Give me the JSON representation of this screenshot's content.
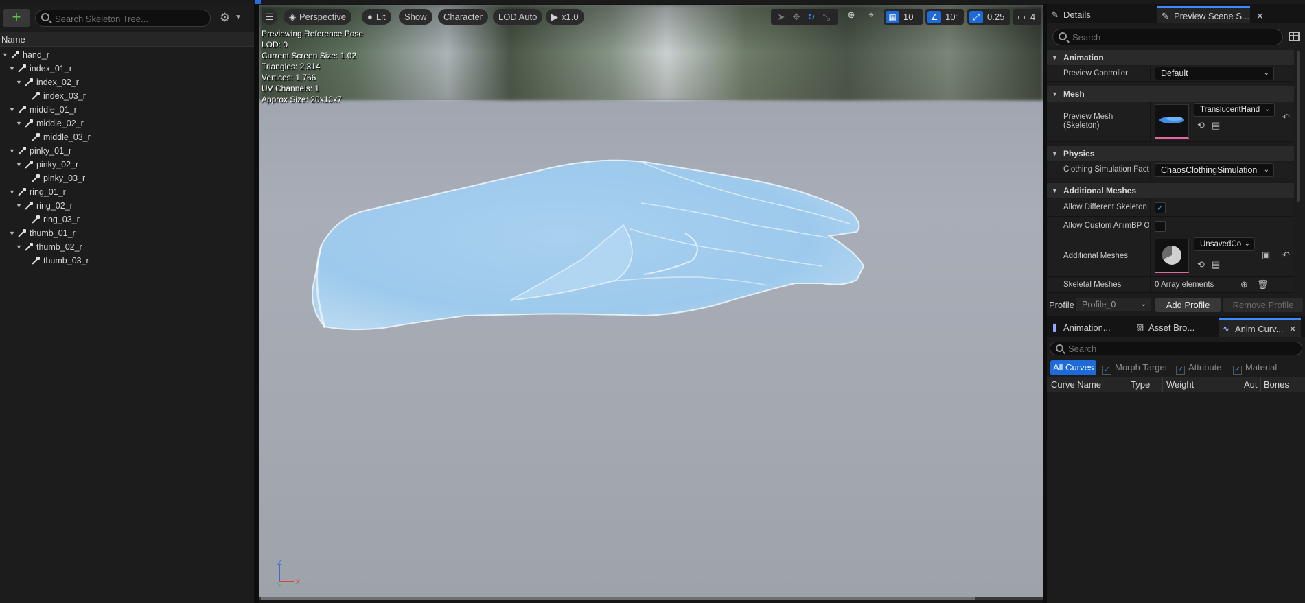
{
  "skeleton_tree": {
    "add_label": "+",
    "search_placeholder": "Search Skeleton Tree...",
    "column_name": "Name",
    "bones": [
      {
        "name": "hand_r",
        "depth": 0
      },
      {
        "name": "index_01_r",
        "depth": 1
      },
      {
        "name": "index_02_r",
        "depth": 2
      },
      {
        "name": "index_03_r",
        "depth": 3
      },
      {
        "name": "middle_01_r",
        "depth": 1
      },
      {
        "name": "middle_02_r",
        "depth": 2
      },
      {
        "name": "middle_03_r",
        "depth": 3
      },
      {
        "name": "pinky_01_r",
        "depth": 1
      },
      {
        "name": "pinky_02_r",
        "depth": 2
      },
      {
        "name": "pinky_03_r",
        "depth": 3
      },
      {
        "name": "ring_01_r",
        "depth": 1
      },
      {
        "name": "ring_02_r",
        "depth": 2
      },
      {
        "name": "ring_03_r",
        "depth": 3
      },
      {
        "name": "thumb_01_r",
        "depth": 1
      },
      {
        "name": "thumb_02_r",
        "depth": 2
      },
      {
        "name": "thumb_03_r",
        "depth": 3
      }
    ]
  },
  "viewport": {
    "toolbar": {
      "menu_icon": "hamburger-icon",
      "perspective": "Perspective",
      "lit": "Lit",
      "show": "Show",
      "character": "Character",
      "lod": "LOD Auto",
      "play_speed": "x1.0",
      "grid_snap": "10",
      "rotation_snap": "10°",
      "scale_snap": "0.25",
      "camera_speed": "4"
    },
    "stats": [
      "Previewing Reference Pose",
      "LOD: 0",
      "Current Screen Size: 1.02",
      "Triangles: 2,314",
      "Vertices: 1,766",
      "UV Channels: 1",
      "Approx Size: 20x13x7"
    ],
    "axis": {
      "z": "Z",
      "x": "X",
      "y": "Y"
    }
  },
  "details": {
    "tabs": [
      {
        "label": "Details",
        "icon": "pencil-icon"
      },
      {
        "label": "Preview Scene S...",
        "icon": "pencil-icon",
        "close": "✕"
      }
    ],
    "search_placeholder": "Search",
    "sections": {
      "animation": {
        "title": "Animation",
        "preview_controller_label": "Preview Controller",
        "preview_controller_value": "Default"
      },
      "mesh": {
        "title": "Mesh",
        "preview_mesh_label": "Preview Mesh (Skeleton)",
        "preview_mesh_value": "TranslucentHand"
      },
      "physics": {
        "title": "Physics",
        "clothing_label": "Clothing Simulation Fact",
        "clothing_value": "ChaosClothingSimulation"
      },
      "additional_meshes": {
        "title": "Additional Meshes",
        "allow_diff_skel_label": "Allow Different Skeleton",
        "allow_diff_skel_checked": true,
        "allow_custom_animbp_label": "Allow Custom AnimBP O",
        "allow_custom_animbp_checked": false,
        "additional_meshes_label": "Additional Meshes",
        "additional_meshes_value": "UnsavedCo",
        "skeletal_meshes_label": "Skeletal Meshes",
        "skeletal_meshes_value": "0 Array elements"
      }
    },
    "profile": {
      "label": "Profile",
      "value": "Profile_0",
      "add_button": "Add Profile",
      "remove_button": "Remove Profile"
    }
  },
  "bottom_panel": {
    "tabs": [
      {
        "label": "Animation..."
      },
      {
        "label": "Asset Bro..."
      },
      {
        "label": "Anim Curv...",
        "close": "✕"
      }
    ],
    "search_placeholder": "Search",
    "filters": {
      "all_curves": "All Curves",
      "morph_target": "Morph Target",
      "attribute": "Attribute",
      "material": "Material"
    },
    "columns": [
      "Curve Name",
      "Type",
      "Weight",
      "Auto",
      "Bones"
    ]
  }
}
